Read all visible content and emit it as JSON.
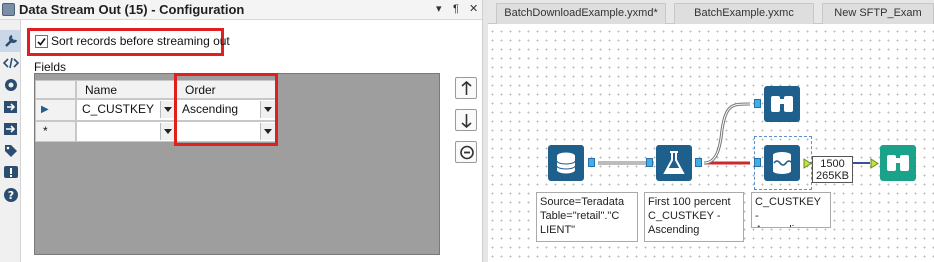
{
  "config_panel": {
    "title": "Data Stream Out (15) - Configuration",
    "titlebar_buttons": {
      "menu": "▾",
      "pin": "¶",
      "close": "✕"
    },
    "sort_option": {
      "label": "Sort records before streaming out",
      "checked": true
    },
    "fields_label": "Fields",
    "grid": {
      "columns": [
        "Name",
        "Order"
      ],
      "rows": [
        {
          "indicator": "▶",
          "name": "C_CUSTKEY",
          "order": "Ascending"
        },
        {
          "indicator": "*",
          "name": "",
          "order": ""
        }
      ]
    },
    "vertical_toolbar": [
      "wrench-icon",
      "code-icon",
      "gear-icon",
      "import-icon",
      "export-icon",
      "tag-icon",
      "error-icon",
      "help-icon"
    ],
    "side_buttons": [
      "move-up-icon",
      "move-down-icon",
      "remove-icon"
    ]
  },
  "canvas": {
    "tabs": [
      "BatchDownloadExample.yxmd*",
      "BatchExample.yxmc",
      "New SFTP_Exam"
    ],
    "annotations": {
      "source": "Source=Teradata\nTable=\"retail\".\"C\nLIENT\"",
      "sample": "First 100 percent\nC_CUSTKEY -\nAscending",
      "stream_out": "C_CUSTKEY -\nAscending"
    },
    "browse_badge": {
      "records": "1500",
      "size": "265KB"
    }
  },
  "colors": {
    "highlight": "#e02020",
    "tool_blue": "#1f5f8b",
    "tool_green": "#1aa38a",
    "anchor": "#3db0e6"
  }
}
